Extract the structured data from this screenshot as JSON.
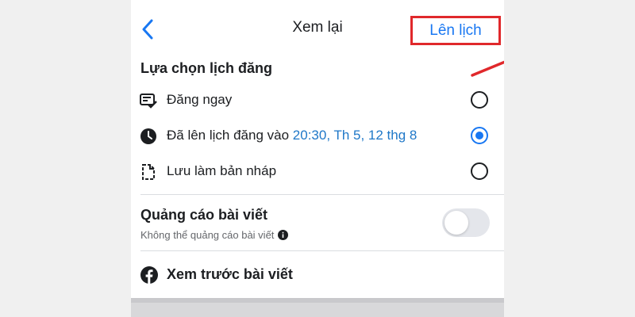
{
  "header": {
    "title": "Xem lại",
    "schedule_button": "Lên lịch"
  },
  "publish_options": {
    "title": "Lựa chọn lịch đăng",
    "options": [
      {
        "label": "Đăng ngay",
        "icon": "post-now-icon",
        "selected": false
      },
      {
        "label": "Đã lên lịch đăng vào",
        "value": "20:30, Th 5, 12 thg 8",
        "icon": "clock-icon",
        "selected": true
      },
      {
        "label": "Lưu làm bản nháp",
        "icon": "draft-icon",
        "selected": false
      }
    ]
  },
  "boost": {
    "title": "Quảng cáo bài viết",
    "subtitle": "Không thể quảng cáo bài viết",
    "enabled": false
  },
  "preview": {
    "label": "Xem trước bài viết",
    "icon": "facebook-icon"
  },
  "colors": {
    "accent": "#1877f2",
    "link_text": "#1f78c8",
    "highlight_box": "#e0282b"
  }
}
